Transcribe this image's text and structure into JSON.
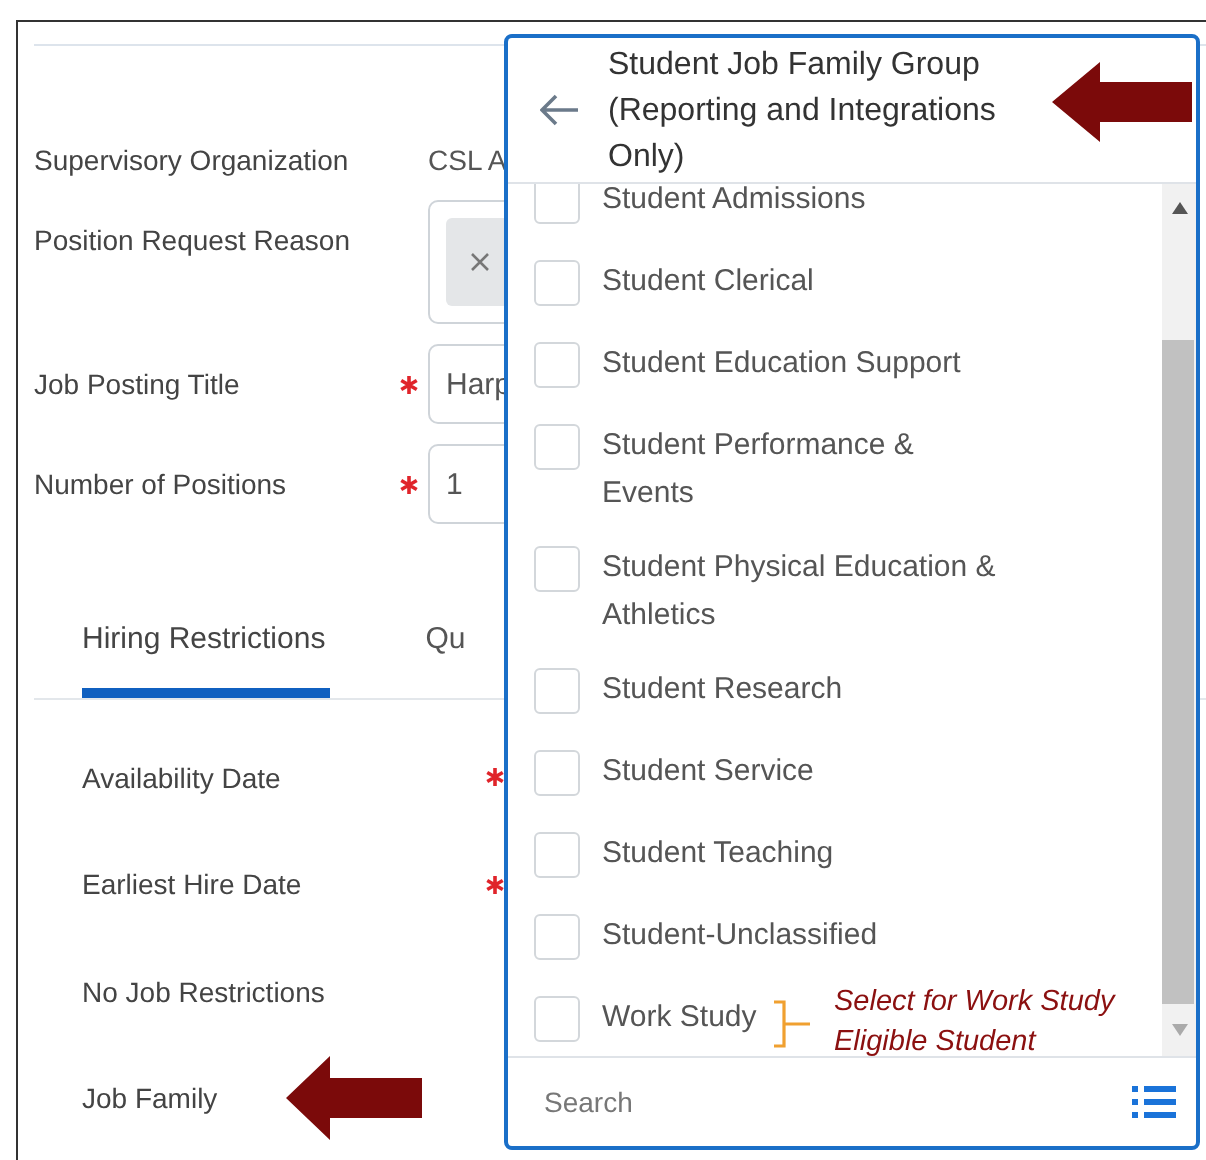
{
  "form": {
    "fields": [
      {
        "label": "Supervisory Organization",
        "kind": "text",
        "value": "CSL A",
        "required": false
      },
      {
        "label": "Position Request Reason",
        "kind": "chips",
        "required": false
      },
      {
        "label": "Job Posting Title",
        "kind": "input",
        "value": "Harp",
        "required": true
      },
      {
        "label": "Number of Positions",
        "kind": "input",
        "value": "1",
        "required": true
      }
    ]
  },
  "tabs": [
    {
      "label": "Hiring Restrictions",
      "selected": true
    },
    {
      "label": "Qu",
      "selected": false
    }
  ],
  "restrictions": [
    {
      "label": "Availability Date",
      "required": true,
      "pointer": false
    },
    {
      "label": "Earliest Hire Date",
      "required": true,
      "pointer": false
    },
    {
      "label": "No Job Restrictions",
      "required": false,
      "pointer": false
    },
    {
      "label": "Job Family",
      "required": false,
      "pointer": true
    }
  ],
  "dropdown": {
    "title": "Student Job Family Group (Reporting and Integrations Only)",
    "pointer": true,
    "options": [
      {
        "label": "Student Admissions",
        "checked": false
      },
      {
        "label": "Student Clerical",
        "checked": false
      },
      {
        "label": "Student Education Support",
        "checked": false
      },
      {
        "label": "Student Performance & Events",
        "checked": false
      },
      {
        "label": "Student Physical Education & Athletics",
        "checked": false
      },
      {
        "label": "Student Research",
        "checked": false
      },
      {
        "label": "Student Service",
        "checked": false
      },
      {
        "label": "Student Teaching",
        "checked": false
      },
      {
        "label": "Student-Unclassified",
        "checked": false
      },
      {
        "label": "Work Study",
        "checked": false,
        "note": "Select for Work Study Eligible Student"
      }
    ],
    "search": {
      "placeholder": "Search"
    }
  }
}
